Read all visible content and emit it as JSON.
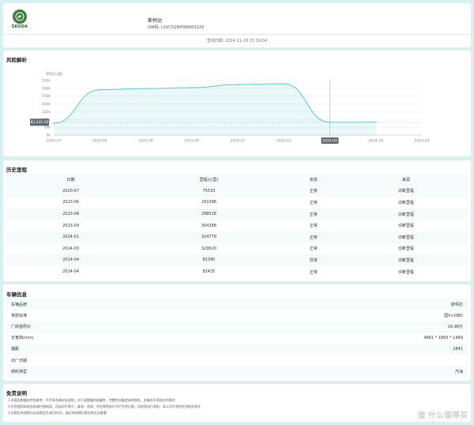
{
  "header": {
    "brand_logo_text": "ŠKODA",
    "car_name": "斯柯达",
    "vin": "VIN码: LSVCD2NP0JN063229",
    "query_date": "查询日期: 2024-11-28 15:59:04"
  },
  "risk": {
    "title": "风险解析",
    "tooltip_value": "82,435.00",
    "highlighted_x": "2024-04"
  },
  "chart_data": {
    "type": "area",
    "title": "",
    "xlabel": "",
    "ylabel": "单位(公里)",
    "x_ticks": [
      "2020-07",
      "2023-06",
      "2023-08",
      "2023-09",
      "2024-01",
      "2024-03",
      "2024-04",
      "2024-04",
      "2024-04"
    ],
    "y_ticks": [
      "0k",
      "50k",
      "100k",
      "150k",
      "200k",
      "250k",
      "300k",
      "350k"
    ],
    "ylim": [
      0,
      350000
    ],
    "series": [
      {
        "x": [
          "2020-07",
          "2023-06",
          "2023-08",
          "2023-09",
          "2024-01",
          "2024-03",
          "2024-04",
          "2024-04"
        ],
        "values": [
          75533,
          291096,
          298518,
          304398,
          324779,
          329620,
          82390,
          82435
        ]
      }
    ],
    "line_color": "#5cc9c3",
    "grid": true
  },
  "history": {
    "title": "历史里程",
    "columns": [
      "日期",
      "里程(公里)",
      "状态",
      "来源"
    ],
    "rows": [
      [
        "2020-07",
        "75533",
        "正常",
        "诊断里程"
      ],
      [
        "2023-06",
        "291096",
        "正常",
        "诊断里程"
      ],
      [
        "2023-08",
        "298518",
        "正常",
        "诊断里程"
      ],
      [
        "2023-09",
        "304398",
        "正常",
        "诊断里程"
      ],
      [
        "2024-01",
        "324779",
        "正常",
        "诊断里程"
      ],
      [
        "2024-03",
        "329620",
        "正常",
        "诊断里程"
      ],
      [
        "2024-04",
        "82390",
        "异常",
        "诊断里程"
      ],
      [
        "2024-04",
        "82435",
        "正常",
        "诊断里程"
      ]
    ]
  },
  "vehicle": {
    "title": "车辆信息",
    "rows": [
      {
        "label": "车辆品牌",
        "value": "斯柯达"
      },
      {
        "label": "排放标准",
        "value": "国V+OBD"
      },
      {
        "label": "厂商指导价",
        "value": "16.98万"
      },
      {
        "label": "长宽高(mm)",
        "value": "4861 * 1865 * 1489"
      },
      {
        "label": "轴距",
        "value": "2841"
      },
      {
        "label": "出厂日期",
        "value": ""
      },
      {
        "label": "燃料类型",
        "value": "汽油"
      }
    ]
  },
  "disclaimer": {
    "title": "免责说明",
    "lines": [
      "1.本报告数据仅供您参考，不代表车辆实际里程，对于因数据的准确性、完整性问题造成的损失，本服务不承担任何责任",
      "2.在您使用本报告前请仔细阅读，包括但不限于，查询、咨询、评估等相关行为产生的后果，均由您自行承担，本公司不承担任何相关责任",
      "3.本报告有效期为自本报告生成后60天，超过有效期后报告将无法查看"
    ]
  },
  "watermark": "值 什么值得买"
}
